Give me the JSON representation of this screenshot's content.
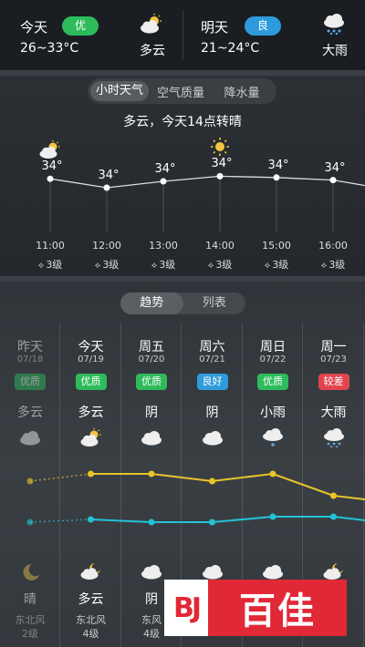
{
  "summary": {
    "today": {
      "day": "今天",
      "aqi": "优",
      "aqi_color": "#2dbb5b",
      "range": "26~33°C",
      "cond": "多云",
      "icon": "partly-cloudy-icon"
    },
    "tomorrow": {
      "day": "明天",
      "aqi": "良",
      "aqi_color": "#2e9bdc",
      "range": "21~24°C",
      "cond": "大雨",
      "icon": "heavy-rain-icon"
    }
  },
  "hourly": {
    "tabs": [
      "小时天气",
      "空气质量",
      "降水量"
    ],
    "summary": "多云，今天14点转晴",
    "hours": [
      {
        "time": "11:00",
        "temp": "34°",
        "wind": "3级",
        "icon": "partly-cloudy-icon",
        "value": 34.0
      },
      {
        "time": "12:00",
        "temp": "34°",
        "wind": "3级",
        "icon": "",
        "value": 33.3
      },
      {
        "time": "13:00",
        "temp": "34°",
        "wind": "3级",
        "icon": "",
        "value": 33.8
      },
      {
        "time": "14:00",
        "temp": "34°",
        "wind": "3级",
        "icon": "sun-icon",
        "value": 34.2
      },
      {
        "time": "15:00",
        "temp": "34°",
        "wind": "3级",
        "icon": "",
        "value": 34.1
      },
      {
        "time": "16:00",
        "temp": "34°",
        "wind": "3级",
        "icon": "",
        "value": 33.9
      }
    ]
  },
  "daily": {
    "tabs": [
      "趋势",
      "列表"
    ],
    "days": [
      {
        "name": "昨天",
        "date": "07/18",
        "aqi": "优质",
        "aqi_color": "#2dbb5b",
        "cond": "多云",
        "icon": "cloud-icon",
        "high": "34°",
        "low": "26°",
        "night_icon": "moon-icon",
        "night_cond": "晴",
        "wind": "东北风",
        "level": "2级",
        "past": true,
        "high_v": 34,
        "low_v": 26
      },
      {
        "name": "今天",
        "date": "07/19",
        "aqi": "优质",
        "aqi_color": "#2dbb5b",
        "cond": "多云",
        "icon": "partly-cloudy-icon",
        "high": "35°",
        "low": "27°",
        "night_icon": "cloud-moon-icon",
        "night_cond": "多云",
        "wind": "东北风",
        "level": "4级",
        "past": false,
        "high_v": 35,
        "low_v": 27
      },
      {
        "name": "周五",
        "date": "07/20",
        "aqi": "优质",
        "aqi_color": "#2dbb5b",
        "cond": "阴",
        "icon": "cloud-icon",
        "high": "35°",
        "low": "26°",
        "night_icon": "cloud-icon",
        "night_cond": "阴",
        "wind": "东风",
        "level": "4级",
        "past": false,
        "high_v": 35,
        "low_v": 26
      },
      {
        "name": "周六",
        "date": "07/21",
        "aqi": "良好",
        "aqi_color": "#2e9bdc",
        "cond": "阴",
        "icon": "cloud-icon",
        "high": "34°",
        "low": "26°",
        "night_icon": "cloud-icon",
        "night_cond": "",
        "wind": "",
        "level": "",
        "past": false,
        "high_v": 34,
        "low_v": 26
      },
      {
        "name": "周日",
        "date": "07/22",
        "aqi": "优质",
        "aqi_color": "#2dbb5b",
        "cond": "小雨",
        "icon": "light-rain-icon",
        "high": "35°",
        "low": "28°",
        "night_icon": "cloud-icon",
        "night_cond": "",
        "wind": "",
        "level": "",
        "past": false,
        "high_v": 35,
        "low_v": 28
      },
      {
        "name": "周一",
        "date": "07/23",
        "aqi": "较差",
        "aqi_color": "#e0454e",
        "cond": "大雨",
        "icon": "heavy-rain-icon",
        "high": "32°",
        "low": "28°",
        "night_icon": "cloud-moon-icon",
        "night_cond": "",
        "wind": "",
        "level": "",
        "past": false,
        "high_v": 32,
        "low_v": 28
      }
    ]
  },
  "watermark": {
    "mark": "BJ",
    "text": "百佳"
  },
  "colors": {
    "high_line": "#e8c62a",
    "low_line": "#23c3d6"
  }
}
